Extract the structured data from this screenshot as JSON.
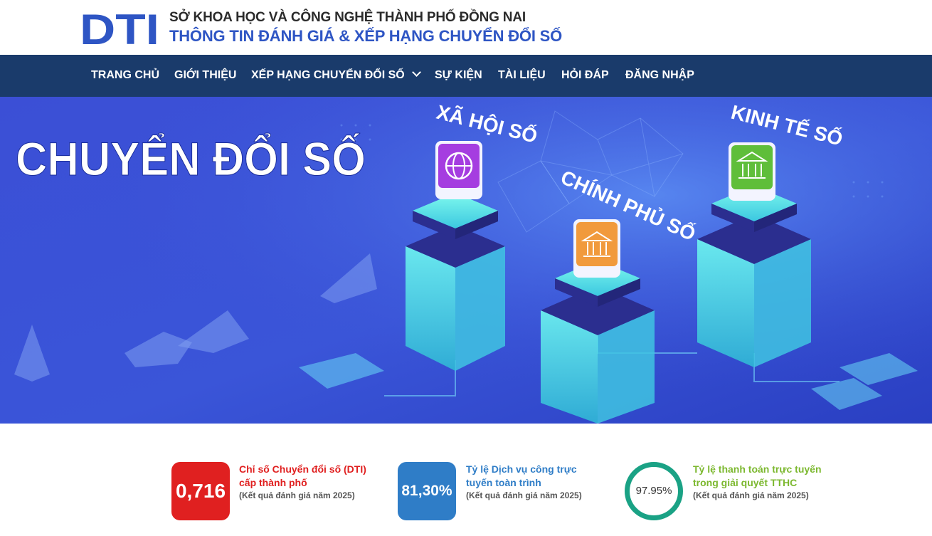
{
  "header": {
    "logo_text": "DTI",
    "org_name": "SỞ KHOA HỌC VÀ CÔNG NGHỆ THÀNH PHỐ ĐỒNG NAI",
    "site_title": "THÔNG TIN ĐÁNH GIÁ & XẾP HẠNG CHUYỂN ĐỔI SỐ"
  },
  "nav": {
    "items": [
      {
        "label": "TRANG CHỦ"
      },
      {
        "label": "GIỚI THIỆU"
      },
      {
        "label": "XẾP HẠNG CHUYỂN ĐỔI SỐ",
        "icon": "chevron-down-icon"
      },
      {
        "label": "SỰ KIỆN"
      },
      {
        "label": "TÀI LIỆU"
      },
      {
        "label": "HỎI ĐÁP"
      },
      {
        "label": "ĐĂNG NHẬP"
      }
    ]
  },
  "banner": {
    "headline": "CHUYỂN ĐỔI SỐ",
    "pillars": [
      {
        "label": "XÃ HỘI SỐ",
        "icon": "globe-icon"
      },
      {
        "label": "CHÍNH PHỦ SỐ",
        "icon": "government-building-icon"
      },
      {
        "label": "KINH TẾ SỐ",
        "icon": "bank-icon"
      }
    ],
    "slides_count": 3,
    "active_slide": 1
  },
  "stats": [
    {
      "value": "0,716",
      "title": "Chỉ số Chuyển đổi số (DTI) cấp thành phố",
      "subtitle": "(Kết quả đánh giá năm 2025)",
      "color": "#e02020"
    },
    {
      "value": "81,30%",
      "title": "Tỷ lệ Dịch vụ công trực tuyến toàn trình",
      "subtitle": "(Kết quả đánh giá năm 2025)",
      "color": "#2f7dc7"
    },
    {
      "value": "97.95%",
      "title": "Tỷ lệ thanh toán trực tuyến trong giải quyết TTHC",
      "subtitle": "(Kết quả đánh giá năm 2025)",
      "color": "#7cb82f",
      "ring_color": "#1aa285"
    }
  ],
  "colors": {
    "nav_bg": "#1a3b6b",
    "brand_blue": "#2e55c4",
    "banner_bg": "#3a52d4"
  }
}
